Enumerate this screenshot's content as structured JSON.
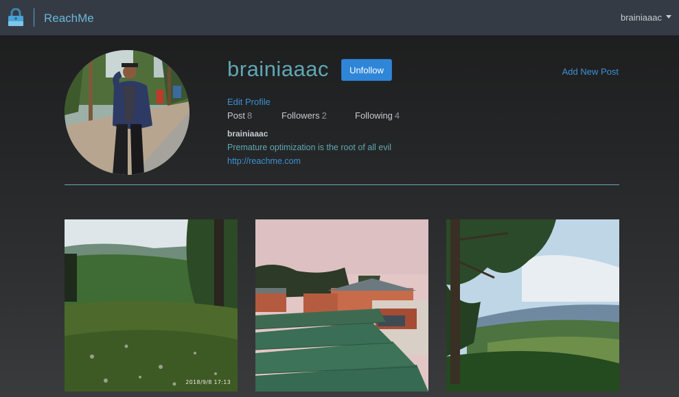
{
  "navbar": {
    "brand_name": "ReachMe",
    "logo_icon": "lock-icon",
    "user_menu_label": "brainiaaac"
  },
  "profile": {
    "username": "brainiaaac",
    "follow_button_label": "Unfollow",
    "add_new_post_label": "Add New Post",
    "edit_profile_label": "Edit Profile",
    "stats": {
      "posts_label": "Post",
      "posts_count": "8",
      "followers_label": "Followers",
      "followers_count": "2",
      "following_label": "Following",
      "following_count": "4"
    },
    "bio": {
      "name": "brainiaaac",
      "text": "Premature optimization is the root of all evil",
      "link": "http://reachme.com"
    }
  },
  "posts": [
    {
      "timestamp": "2018/9/8  17:13"
    },
    {
      "timestamp": ""
    },
    {
      "timestamp": ""
    }
  ],
  "colors": {
    "navbar_bg": "#353b45",
    "accent": "#5fa8b4",
    "link": "#3b92d6",
    "button": "#2f86d8"
  }
}
